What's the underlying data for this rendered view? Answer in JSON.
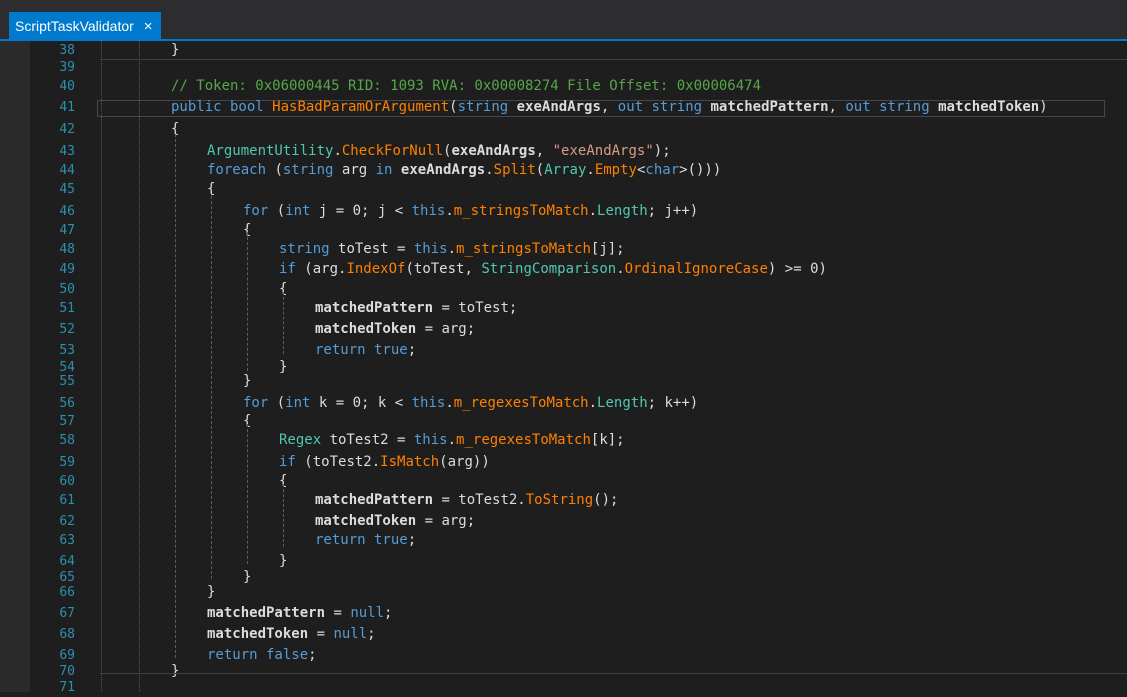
{
  "tab": {
    "title": "ScriptTaskValidator",
    "close": "×"
  },
  "lines": [
    {
      "n": "38",
      "indent": 0,
      "parts": [
        [
          "p",
          "}"
        ]
      ]
    },
    {
      "n": "39",
      "indent": 0,
      "parts": []
    },
    {
      "n": "40",
      "indent": 0,
      "parts": [
        [
          "cm",
          "// Token: 0x06000445 RID: 1093 RVA: 0x00008274 File Offset: 0x00006474"
        ]
      ]
    },
    {
      "n": "41",
      "indent": 0,
      "parts": [
        [
          "kw",
          "public bool "
        ],
        [
          "me",
          "HasBadParamOrArgument"
        ],
        [
          "p",
          "("
        ],
        [
          "kw",
          "string "
        ],
        [
          "bd",
          "exeAndArgs"
        ],
        [
          "p",
          ", "
        ],
        [
          "kw",
          "out string "
        ],
        [
          "bd",
          "matchedPattern"
        ],
        [
          "p",
          ", "
        ],
        [
          "kw",
          "out string "
        ],
        [
          "bd",
          "matchedToken"
        ],
        [
          "p",
          ")"
        ]
      ]
    },
    {
      "n": "42",
      "indent": 0,
      "parts": [
        [
          "p",
          "{"
        ]
      ]
    },
    {
      "n": "43",
      "indent": 1,
      "parts": [
        [
          "ty",
          "ArgumentUtility"
        ],
        [
          "p",
          "."
        ],
        [
          "me",
          "CheckForNull"
        ],
        [
          "p",
          "("
        ],
        [
          "bd",
          "exeAndArgs"
        ],
        [
          "p",
          ", "
        ],
        [
          "st",
          "\"exeAndArgs\""
        ],
        [
          "p",
          ");"
        ]
      ]
    },
    {
      "n": "44",
      "indent": 1,
      "parts": [
        [
          "kw",
          "foreach "
        ],
        [
          "p",
          "("
        ],
        [
          "kw",
          "string "
        ],
        [
          "p",
          "arg "
        ],
        [
          "kw",
          "in "
        ],
        [
          "bd",
          "exeAndArgs"
        ],
        [
          "p",
          "."
        ],
        [
          "me",
          "Split"
        ],
        [
          "p",
          "("
        ],
        [
          "ty",
          "Array"
        ],
        [
          "p",
          "."
        ],
        [
          "me",
          "Empty"
        ],
        [
          "p",
          "<"
        ],
        [
          "kw",
          "char"
        ],
        [
          "p",
          ">()))"
        ]
      ]
    },
    {
      "n": "45",
      "indent": 1,
      "parts": [
        [
          "p",
          "{"
        ]
      ]
    },
    {
      "n": "46",
      "indent": 2,
      "parts": [
        [
          "kw",
          "for "
        ],
        [
          "p",
          "("
        ],
        [
          "kw",
          "int "
        ],
        [
          "p",
          "j = 0; j < "
        ],
        [
          "kw",
          "this"
        ],
        [
          "p",
          "."
        ],
        [
          "me",
          "m_stringsToMatch"
        ],
        [
          "p",
          "."
        ],
        [
          "ty",
          "Length"
        ],
        [
          "p",
          "; j++)"
        ]
      ]
    },
    {
      "n": "47",
      "indent": 2,
      "parts": [
        [
          "p",
          "{"
        ]
      ]
    },
    {
      "n": "48",
      "indent": 3,
      "parts": [
        [
          "kw",
          "string "
        ],
        [
          "p",
          "toTest = "
        ],
        [
          "kw",
          "this"
        ],
        [
          "p",
          "."
        ],
        [
          "me",
          "m_stringsToMatch"
        ],
        [
          "p",
          "[j];"
        ]
      ]
    },
    {
      "n": "49",
      "indent": 3,
      "parts": [
        [
          "kw",
          "if "
        ],
        [
          "p",
          "(arg."
        ],
        [
          "me",
          "IndexOf"
        ],
        [
          "p",
          "(toTest, "
        ],
        [
          "ty",
          "StringComparison"
        ],
        [
          "p",
          "."
        ],
        [
          "me",
          "OrdinalIgnoreCase"
        ],
        [
          "p",
          ") >= 0)"
        ]
      ]
    },
    {
      "n": "50",
      "indent": 3,
      "parts": [
        [
          "p",
          "{"
        ]
      ]
    },
    {
      "n": "51",
      "indent": 4,
      "parts": [
        [
          "bd",
          "matchedPattern"
        ],
        [
          "p",
          " = toTest;"
        ]
      ]
    },
    {
      "n": "52",
      "indent": 4,
      "parts": [
        [
          "bd",
          "matchedToken"
        ],
        [
          "p",
          " = arg;"
        ]
      ]
    },
    {
      "n": "53",
      "indent": 4,
      "parts": [
        [
          "kw",
          "return true"
        ],
        [
          "p",
          ";"
        ]
      ]
    },
    {
      "n": "54",
      "indent": 3,
      "parts": [
        [
          "p",
          "}"
        ]
      ]
    },
    {
      "n": "55",
      "indent": 2,
      "parts": [
        [
          "p",
          "}"
        ]
      ]
    },
    {
      "n": "56",
      "indent": 2,
      "parts": [
        [
          "kw",
          "for "
        ],
        [
          "p",
          "("
        ],
        [
          "kw",
          "int "
        ],
        [
          "p",
          "k = 0; k < "
        ],
        [
          "kw",
          "this"
        ],
        [
          "p",
          "."
        ],
        [
          "me",
          "m_regexesToMatch"
        ],
        [
          "p",
          "."
        ],
        [
          "ty",
          "Length"
        ],
        [
          "p",
          "; k++)"
        ]
      ]
    },
    {
      "n": "57",
      "indent": 2,
      "parts": [
        [
          "p",
          "{"
        ]
      ]
    },
    {
      "n": "58",
      "indent": 3,
      "parts": [
        [
          "ty",
          "Regex "
        ],
        [
          "p",
          "toTest2 = "
        ],
        [
          "kw",
          "this"
        ],
        [
          "p",
          "."
        ],
        [
          "me",
          "m_regexesToMatch"
        ],
        [
          "p",
          "[k];"
        ]
      ]
    },
    {
      "n": "59",
      "indent": 3,
      "parts": [
        [
          "kw",
          "if "
        ],
        [
          "p",
          "(toTest2."
        ],
        [
          "me",
          "IsMatch"
        ],
        [
          "p",
          "(arg))"
        ]
      ]
    },
    {
      "n": "60",
      "indent": 3,
      "parts": [
        [
          "p",
          "{"
        ]
      ]
    },
    {
      "n": "61",
      "indent": 4,
      "parts": [
        [
          "bd",
          "matchedPattern"
        ],
        [
          "p",
          " = toTest2."
        ],
        [
          "me",
          "ToString"
        ],
        [
          "p",
          "();"
        ]
      ]
    },
    {
      "n": "62",
      "indent": 4,
      "parts": [
        [
          "bd",
          "matchedToken"
        ],
        [
          "p",
          " = arg;"
        ]
      ]
    },
    {
      "n": "63",
      "indent": 4,
      "parts": [
        [
          "kw",
          "return true"
        ],
        [
          "p",
          ";"
        ]
      ]
    },
    {
      "n": "64",
      "indent": 3,
      "parts": [
        [
          "p",
          "}"
        ]
      ]
    },
    {
      "n": "65",
      "indent": 2,
      "parts": [
        [
          "p",
          "}"
        ]
      ]
    },
    {
      "n": "66",
      "indent": 1,
      "parts": [
        [
          "p",
          "}"
        ]
      ]
    },
    {
      "n": "67",
      "indent": 1,
      "parts": [
        [
          "bd",
          "matchedPattern"
        ],
        [
          "p",
          " = "
        ],
        [
          "kw",
          "null"
        ],
        [
          "p",
          ";"
        ]
      ]
    },
    {
      "n": "68",
      "indent": 1,
      "parts": [
        [
          "bd",
          "matchedToken"
        ],
        [
          "p",
          " = "
        ],
        [
          "kw",
          "null"
        ],
        [
          "p",
          ";"
        ]
      ]
    },
    {
      "n": "69",
      "indent": 1,
      "parts": [
        [
          "kw",
          "return false"
        ],
        [
          "p",
          ";"
        ]
      ]
    },
    {
      "n": "70",
      "indent": 0,
      "parts": [
        [
          "p",
          "}"
        ]
      ]
    },
    {
      "n": "71",
      "indent": 0,
      "parts": []
    }
  ],
  "colors": {
    "keyword": "#569cd6",
    "type": "#4ec9b0",
    "method": "#ff8000",
    "string": "#d69d85",
    "comment": "#57a64a",
    "line_number": "#2b91af",
    "tab_accent": "#007acc"
  }
}
